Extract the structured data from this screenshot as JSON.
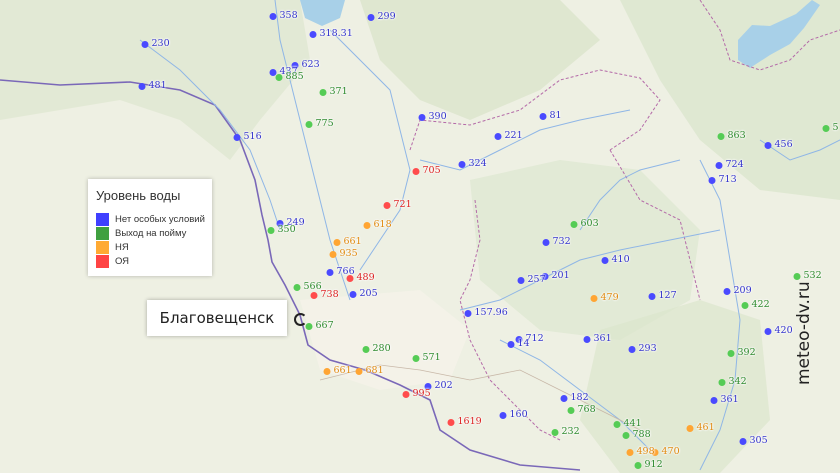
{
  "legend": {
    "title": "Уровень воды",
    "items": [
      {
        "label": "Нет особых условий",
        "color": "#4040ff"
      },
      {
        "label": "Выход на пойму",
        "color": "#40a040"
      },
      {
        "label": "НЯ",
        "color": "#ffaa33"
      },
      {
        "label": "ОЯ",
        "color": "#ff4444"
      }
    ]
  },
  "city": {
    "name": "Благовещенск"
  },
  "watermark": "meteo-dv.ru",
  "stations": [
    {
      "value": "358",
      "level": "normal"
    },
    {
      "value": "299",
      "level": "normal"
    },
    {
      "value": "318.31",
      "level": "normal"
    },
    {
      "value": "230",
      "level": "normal"
    },
    {
      "value": "623",
      "level": "normal"
    },
    {
      "value": "437",
      "level": "normal"
    },
    {
      "value": "885",
      "level": "flood"
    },
    {
      "value": "481",
      "level": "normal"
    },
    {
      "value": "371",
      "level": "flood"
    },
    {
      "value": "390",
      "level": "normal"
    },
    {
      "value": "81",
      "level": "normal"
    },
    {
      "value": "775",
      "level": "flood"
    },
    {
      "value": "516",
      "level": "normal"
    },
    {
      "value": "221",
      "level": "normal"
    },
    {
      "value": "863",
      "level": "flood"
    },
    {
      "value": "456",
      "level": "normal"
    },
    {
      "value": "5",
      "level": "flood"
    },
    {
      "value": "324",
      "level": "normal"
    },
    {
      "value": "724",
      "level": "normal"
    },
    {
      "value": "705",
      "level": "danger"
    },
    {
      "value": "713",
      "level": "normal"
    },
    {
      "value": "721",
      "level": "danger"
    },
    {
      "value": "249",
      "level": "normal"
    },
    {
      "value": "350",
      "level": "flood"
    },
    {
      "value": "618",
      "level": "warning"
    },
    {
      "value": "603",
      "level": "flood"
    },
    {
      "value": "661",
      "level": "warning"
    },
    {
      "value": "732",
      "level": "normal"
    },
    {
      "value": "935",
      "level": "warning"
    },
    {
      "value": "410",
      "level": "normal"
    },
    {
      "value": "766",
      "level": "normal"
    },
    {
      "value": "489",
      "level": "danger"
    },
    {
      "value": "201",
      "level": "normal"
    },
    {
      "value": "257",
      "level": "normal"
    },
    {
      "value": "532",
      "level": "flood"
    },
    {
      "value": "566",
      "level": "flood"
    },
    {
      "value": "738",
      "level": "danger"
    },
    {
      "value": "205",
      "level": "normal"
    },
    {
      "value": "479",
      "level": "warning"
    },
    {
      "value": "127",
      "level": "normal"
    },
    {
      "value": "209",
      "level": "normal"
    },
    {
      "value": "422",
      "level": "flood"
    },
    {
      "value": "157.96",
      "level": "normal"
    },
    {
      "value": "667",
      "level": "flood"
    },
    {
      "value": "420",
      "level": "normal"
    },
    {
      "value": "712",
      "level": "normal"
    },
    {
      "value": "14",
      "level": "normal"
    },
    {
      "value": "361",
      "level": "normal"
    },
    {
      "value": "280",
      "level": "flood"
    },
    {
      "value": "293",
      "level": "normal"
    },
    {
      "value": "392",
      "level": "flood"
    },
    {
      "value": "571",
      "level": "flood"
    },
    {
      "value": "661",
      "level": "warning"
    },
    {
      "value": "681",
      "level": "warning"
    },
    {
      "value": "342",
      "level": "flood"
    },
    {
      "value": "202",
      "level": "normal"
    },
    {
      "value": "995",
      "level": "danger"
    },
    {
      "value": "182",
      "level": "normal"
    },
    {
      "value": "361",
      "level": "normal"
    },
    {
      "value": "768",
      "level": "flood"
    },
    {
      "value": "160",
      "level": "normal"
    },
    {
      "value": "1619",
      "level": "danger"
    },
    {
      "value": "441",
      "level": "flood"
    },
    {
      "value": "461",
      "level": "warning"
    },
    {
      "value": "232",
      "level": "flood"
    },
    {
      "value": "788",
      "level": "flood"
    },
    {
      "value": "305",
      "level": "normal"
    },
    {
      "value": "470",
      "level": "warning"
    },
    {
      "value": "498",
      "level": "warning"
    },
    {
      "value": "912",
      "level": "flood"
    }
  ],
  "level_colors": {
    "normal": {
      "dot": "#4a4aff",
      "text": "#3333cc"
    },
    "flood": {
      "dot": "#55cc55",
      "text": "#2d8a2d"
    },
    "warning": {
      "dot": "#ffa533",
      "text": "#e08a10"
    },
    "danger": {
      "dot": "#ff4c4c",
      "text": "#dd2222"
    }
  }
}
